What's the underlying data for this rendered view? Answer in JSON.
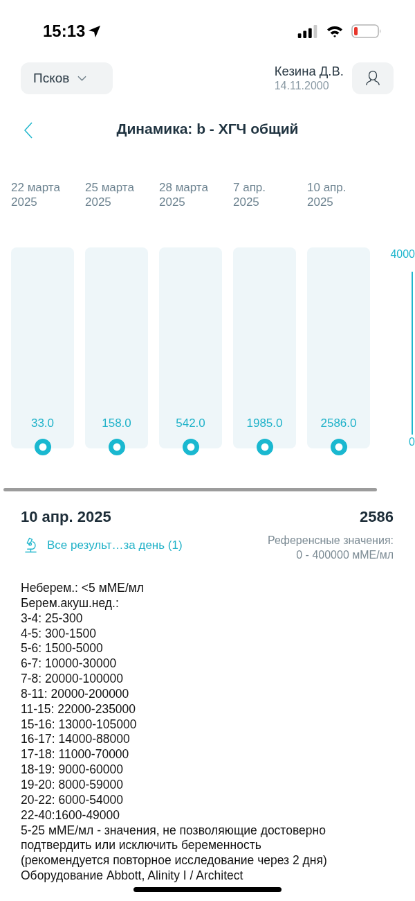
{
  "status_bar": {
    "time": "15:13"
  },
  "header": {
    "city": "Псков",
    "patient_name": "Кезина Д.В.",
    "birth_date": "14.11.2000"
  },
  "title": "Динамика: b - ХГЧ общий",
  "results": {
    "columns": [
      {
        "date": "22 марта\n2025",
        "value": "33.0"
      },
      {
        "date": "25 марта\n2025",
        "value": "158.0"
      },
      {
        "date": "28 марта\n2025",
        "value": "542.0"
      },
      {
        "date": "7 апр.\n2025",
        "value": "1985.0"
      },
      {
        "date": "10 апр.\n2025",
        "value": "2586.0"
      }
    ],
    "axis": {
      "top_label": "4000",
      "bottom_label": "0"
    }
  },
  "selected_result": {
    "date": "10 апр. 2025",
    "value": "2586",
    "link": "Все результ…за день (1)",
    "reference_label": "Референсные значения:",
    "reference_range": "0 - 400000 мМЕ/мл"
  },
  "notes": "Неберем.: <5 мМЕ/мл\nБерем.акуш.нед.:\n3-4: 25-300\n4-5: 300-1500\n5-6: 1500-5000\n6-7: 10000-30000\n7-8: 20000-100000\n8-11: 20000-200000\n11-15: 22000-235000\n15-16: 13000-105000\n16-17: 14000-88000\n17-18: 11000-70000\n18-19: 9000-60000\n19-20: 8000-59000\n20-22: 6000-54000\n22-40:1600-49000\n5-25 мМЕ/мл - значения, не позволяющие достоверно\nподтвердить или исключить беременность\n(рекомендуется повторное исследование через 2 дня)\nОборудование Abbott, Alinity I / Architect"
}
